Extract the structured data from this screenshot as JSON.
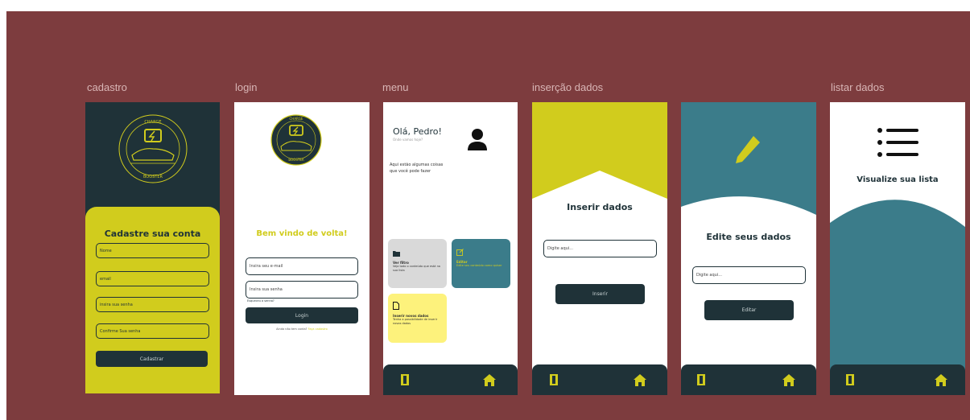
{
  "frames": {
    "cadastro": "cadastro",
    "login": "login",
    "menu": "menu",
    "insercao": "inserção dados",
    "listar": "listar dados"
  },
  "brand": {
    "top_text": "CHARGE",
    "bottom_text": "BOOSTER",
    "accent": "#d1cc1d",
    "dark": "#1f3238",
    "teal": "#3b7c8a",
    "card_gray": "#d9d9d9",
    "card_yellow": "#fdf27c"
  },
  "cadastro": {
    "title": "Cadastre sua conta",
    "name_ph": "Nome",
    "email_ph": "email",
    "pass_ph": "insira sua senha",
    "confirm_ph": "Confirme Sua senha",
    "submit": "Cadastrar"
  },
  "login": {
    "title": "Bem vindo de volta!",
    "email_ph": "Insira seu e-mail",
    "pass_ph": "Insira sua senha",
    "forgot": "Esqueceu a senha?",
    "submit": "Login",
    "no_account": "Ainda não tem conta?",
    "signup": "Faça cadastro"
  },
  "menu": {
    "greeting": "Olá, Pedro!",
    "subgreeting": "Onde vamos hoje?",
    "intro_line1": "Aqui estão algumas coisas",
    "intro_line2": "que você pode fazer",
    "card1_title": "Ver filtro",
    "card1_desc": "Veja todo o conteúdo que está na sua lista",
    "card2_title": "Editar",
    "card2_desc": "Edite seu conteúdo como quiser",
    "card3_title": "Inserir novos dados",
    "card3_desc": "Tenha a possibilidade de inserir novos dados"
  },
  "inserir": {
    "title": "Inserir dados",
    "input_ph": "Digite aqui...",
    "submit": "Inserir"
  },
  "editar": {
    "title": "Edite seus dados",
    "input_ph": "Digite aqui...",
    "submit": "Editar"
  },
  "listar": {
    "title": "Visualize sua lista"
  },
  "icons": {
    "logo": "charge-booster-logo",
    "user": "user-icon",
    "folder": "folder-icon",
    "edit": "edit-icon",
    "file": "file-icon",
    "pencil": "pencil-icon",
    "list": "list-icon",
    "door": "exit-door-icon",
    "home": "home-icon"
  }
}
